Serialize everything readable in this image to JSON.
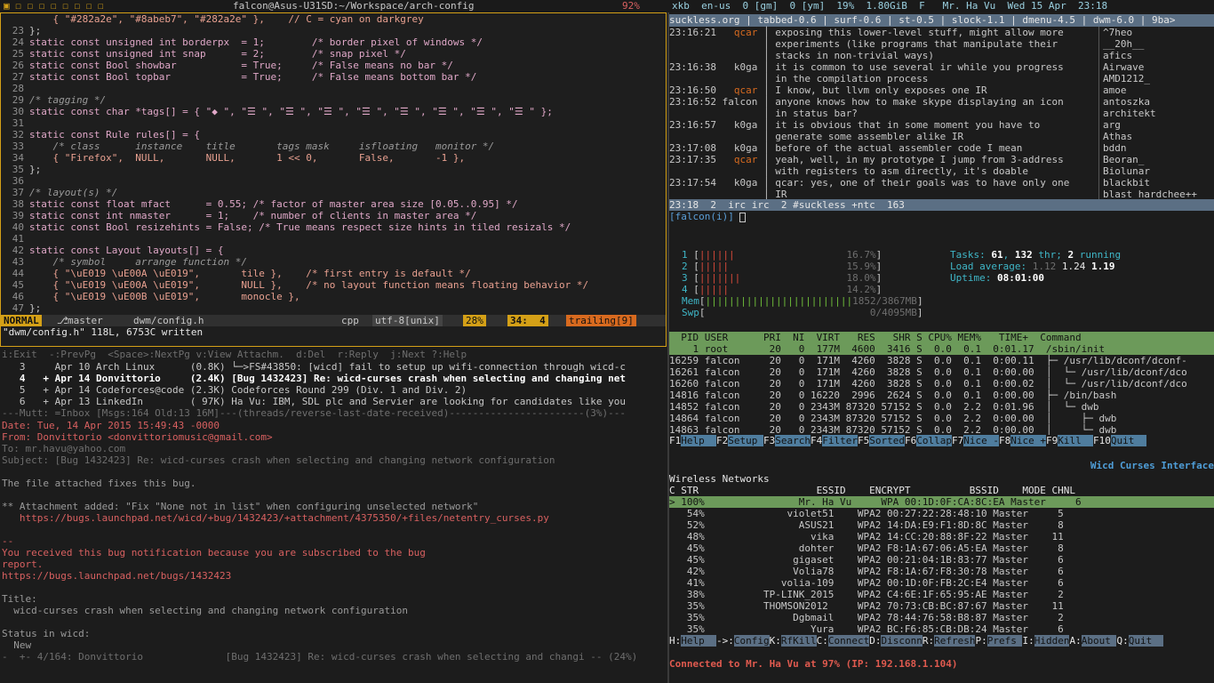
{
  "topbar": {
    "title": "falcon@Asus-U31SD:~/Workspace/arch-config",
    "battery": "92%",
    "right": "xkb  en-us  0 [gm]  0 [ym]  19%  1.80GiB  F   Mr. Ha Vu  Wed 15 Apr  23:18"
  },
  "vim": {
    "lines": [
      [
        "",
        "    { \"#282a2e\", \"#8abeb7\", \"#282a2e\" },    // C = cyan on darkgrey"
      ],
      [
        "23",
        "};"
      ],
      [
        "24",
        "static const unsigned int borderpx  = 1;        /* border pixel of windows */"
      ],
      [
        "25",
        "static const unsigned int snap      = 2;        /* snap pixel */"
      ],
      [
        "26",
        "static const Bool showbar           = True;     /* False means no bar */"
      ],
      [
        "27",
        "static const Bool topbar            = True;     /* False means bottom bar */"
      ],
      [
        "28",
        ""
      ],
      [
        "29",
        "/* tagging */"
      ],
      [
        "30",
        "static const char *tags[] = { \"◆ \", \"☰ \", \"☰ \", \"☰ \", \"☰ \", \"☰ \", \"☰ \", \"☰ \", \"☰ \" };"
      ],
      [
        "31",
        ""
      ],
      [
        "32",
        "static const Rule rules[] = {"
      ],
      [
        "33",
        "    /* class      instance    title       tags mask     isfloating   monitor */"
      ],
      [
        "34",
        "    { \"Firefox\",  NULL,       NULL,       1 << 0,       False,       -1 },"
      ],
      [
        "35",
        "};"
      ],
      [
        "36",
        ""
      ],
      [
        "37",
        "/* layout(s) */"
      ],
      [
        "38",
        "static const float mfact      = 0.55; /* factor of master area size [0.05..0.95] */"
      ],
      [
        "39",
        "static const int nmaster      = 1;    /* number of clients in master area */"
      ],
      [
        "40",
        "static const Bool resizehints = False; /* True means respect size hints in tiled resizals */"
      ],
      [
        "41",
        ""
      ],
      [
        "42",
        "static const Layout layouts[] = {"
      ],
      [
        "43",
        "    /* symbol     arrange function */"
      ],
      [
        "44",
        "    { \"\\uE019 \\uE00A \\uE019\",       tile },    /* first entry is default */"
      ],
      [
        "45",
        "    { \"\\uE019 \\uE00A \\uE019\",       NULL },    /* no layout function means floating behavior */"
      ],
      [
        "46",
        "    { \"\\uE019 \\uE00B \\uE019\",       monocle },"
      ],
      [
        "47",
        "};"
      ]
    ],
    "status_mode": "NORMAL",
    "status_branch": "master",
    "status_file": "dwm/config.h",
    "status_ft": "cpp",
    "status_enc": "utf-8[unix]",
    "status_pos": "28%",
    "status_line": "34:  4",
    "status_trailing": "trailing[9]",
    "cmdline": "\"dwm/config.h\" 118L, 6753C written"
  },
  "mutt": {
    "help": "i:Exit  -:PrevPg  <Space>:NextPg v:View Attachm.  d:Del  r:Reply  j:Next ?:Help",
    "list": [
      "   3     Apr 10 Arch Linux      (0.8K) └─>FS#43850: [wicd] fail to setup up wifi-connection through wicd-c",
      "   4   + Apr 14 Donvittorio     (2.4K) [Bug 1432423] Re: wicd-curses crash when selecting and changing net",
      "   5   + Apr 14 Codeforces@code (2.3K) Codeforces Round 299 (Div. 1 and Div. 2)",
      "   6   + Apr 13 LinkedIn        ( 97K) Ha Vu: IBM, SDL plc and Servier are looking for candidates like you"
    ],
    "statusbar": "---Mutt: =Inbox [Msgs:164 Old:13 16M]---(threads/reverse-last-date-received)-----------------------(3%)---",
    "date": "Date: Tue, 14 Apr 2015 15:49:43 -0000",
    "from": "From: Donvittorio <donvittoriomusic@gmail.com>",
    "to": "To: mr.havu@yahoo.com",
    "subject": "Subject: [Bug 1432423] Re: wicd-curses crash when selecting and changing network configuration",
    "body": [
      "",
      "The file attached fixes this bug.",
      "",
      "** Attachment added: \"Fix \"None not in list\" when configuring unselected network\"",
      "   https://bugs.launchpad.net/wicd/+bug/1432423/+attachment/4375350/+files/netentry_curses.py",
      "",
      "--",
      "You received this bug notification because you are subscribed to the bug",
      "report.",
      "https://bugs.launchpad.net/bugs/1432423",
      "",
      "Title:",
      "  wicd-curses crash when selecting and changing network configuration",
      "",
      "Status in wicd:",
      "  New"
    ],
    "footer": "-  +- 4/164: Donvittorio              [Bug 1432423] Re: wicd-curses crash when selecting and changi -- (24%)"
  },
  "irc": {
    "topic": "suckless.org | tabbed-0.6 | surf-0.6 | st-0.5 | slock-1.1 | dmenu-4.5 | dwm-6.0 | 9ba>",
    "messages": [
      [
        "23:16:21",
        "qcar",
        "exposing this lower-level stuff, might allow more"
      ],
      [
        "",
        "",
        "experiments (like programs that manipulate their"
      ],
      [
        "",
        "",
        "stacks in non-trivial ways)"
      ],
      [
        "23:16:38",
        "k0ga",
        "it is common to use several ir while you progress"
      ],
      [
        "",
        "",
        "in the compilation process"
      ],
      [
        "23:16:50",
        "qcar",
        "I know, but llvm only exposes one IR"
      ],
      [
        "23:16:52",
        "falcon",
        "anyone knows how to make skype displaying an icon"
      ],
      [
        "",
        "",
        "in status bar?"
      ],
      [
        "23:16:57",
        "k0ga",
        "it is obvious that in some moment you have to"
      ],
      [
        "",
        "",
        "generate some assembler alike IR"
      ],
      [
        "23:17:08",
        "k0ga",
        "before of the actual assembler code I mean"
      ],
      [
        "23:17:35",
        "qcar",
        "yeah, well, in my prototype I jump from 3-address"
      ],
      [
        "",
        "",
        "with registers to asm directly, it's doable"
      ],
      [
        "23:17:54",
        "k0ga",
        "qcar: yes, one of their goals was to have only one"
      ],
      [
        "",
        "",
        "IR"
      ]
    ],
    "nicks": [
      "^7heo",
      "__20h__",
      "afics",
      "Airwave",
      "AMD1212_",
      "amoe",
      "antoszka",
      "architekt",
      "arg",
      "Athas",
      "bddn",
      "Beoran_",
      "Biolunar",
      "blackbit",
      "blast_hardchee++"
    ],
    "status": "23:18  2  irc irc  2 #suckless +ntc  163",
    "prompt": "[falcon(i)] "
  },
  "htop": {
    "cpus": [
      [
        "1",
        "||||||",
        "16.7%"
      ],
      [
        "2",
        "|||||",
        "15.9%"
      ],
      [
        "3",
        "|||||||",
        "18.0%"
      ],
      [
        "4",
        "|||||",
        "14.2%"
      ]
    ],
    "cpu_usage": [
      16.7,
      15.9,
      18.0,
      14.2
    ],
    "mem_bars": "|||||||||||||||||||||||||",
    "mem": "1852/3867MB",
    "mem_used_mb": 1852,
    "mem_total_mb": 3867,
    "swp": "0/4095MB",
    "swp_used_mb": 0,
    "swp_total_mb": 4095,
    "tasks_label": "Tasks: ",
    "tasks": "61",
    "thr": "132",
    "running": "2",
    "load_label": "Load average: ",
    "load1": "1.12",
    "load5": "1.24",
    "load15": "1.19",
    "uptime_label": "Uptime: ",
    "uptime": "08:01:00",
    "header": "  PID USER      PRI  NI  VIRT   RES   SHR S CPU% MEM%   TIME+  Command",
    "rows": [
      "    1 root       20   0  177M  4600  3416 S  0.0  0.1  0:01.17  /sbin/init",
      "16259 falcon     20   0  171M  4260  3828 S  0.0  0.1  0:00.11  ├─ /usr/lib/dconf/dconf-",
      "16261 falcon     20   0  171M  4260  3828 S  0.0  0.1  0:00.00  │  └─ /usr/lib/dconf/dco",
      "16260 falcon     20   0  171M  4260  3828 S  0.0  0.1  0:00.02  │  └─ /usr/lib/dconf/dco",
      "14816 falcon     20   0 16220  2996  2624 S  0.0  0.1  0:00.00  ├─ /bin/bash",
      "14852 falcon     20   0 2343M 87320 57152 S  0.0  2.2  0:01.96  │  └─ dwb",
      "14864 falcon     20   0 2343M 87320 57152 S  0.0  2.2  0:00.00  │     ├─ dwb",
      "14863 falcon     20   0 2343M 87320 57152 S  0.0  2.2  0:00.00  │     └─ dwb"
    ],
    "fkeys": [
      [
        "F1",
        "Help  "
      ],
      [
        "F2",
        "Setup "
      ],
      [
        "F3",
        "Search"
      ],
      [
        "F4",
        "Filter"
      ],
      [
        "F5",
        "Sorted"
      ],
      [
        "F6",
        "Collap"
      ],
      [
        "F7",
        "Nice -"
      ],
      [
        "F8",
        "Nice +"
      ],
      [
        "F9",
        "Kill  "
      ],
      [
        "F10",
        "Quit  "
      ]
    ]
  },
  "wicd": {
    "title": "Wicd Curses Interface",
    "heading": "Wireless Networks",
    "columns": "C STR                    ESSID    ENCRYPT          BSSID    MODE CHNL",
    "selected": "> 100%                Mr. Ha Vu     WPA 00:1D:0F:CA:8C:EA Master     6",
    "networks": [
      "   54%              violet51    WPA2 00:27:22:28:48:10 Master     5",
      "   52%                ASUS21    WPA2 14:DA:E9:F1:8D:8C Master     8",
      "   48%                  vika    WPA2 14:CC:20:88:8F:22 Master    11",
      "   45%                dohter    WPA2 F8:1A:67:06:A5:EA Master     8",
      "   45%               gigaset    WPA2 00:21:04:1B:83:77 Master     6",
      "   42%               Volia78    WPA2 F8:1A:67:F8:30:78 Master     6",
      "   41%             volia-109    WPA2 00:1D:0F:FB:2C:E4 Master     6",
      "   38%          TP-LINK_2015    WPA2 C4:6E:1F:65:95:AE Master     2",
      "   35%          THOMSON2012     WPA2 70:73:CB:BC:87:67 Master    11",
      "   35%               Dgbmail    WPA2 78:44:76:58:B8:87 Master     2",
      "   35%                  Yura    WPA2 BC:F6:85:CB:DB:24 Master     6"
    ],
    "keys": [
      [
        "H:",
        "Help  "
      ],
      [
        "->:",
        "Config"
      ],
      [
        "K:",
        "RfKill"
      ],
      [
        "C:",
        "Connect"
      ],
      [
        "D:",
        "Disconn"
      ],
      [
        "R:",
        "Refresh"
      ],
      [
        "P:",
        "Prefs "
      ],
      [
        "I:",
        "Hidden"
      ],
      [
        "A:",
        "About "
      ],
      [
        "Q:",
        "Quit  "
      ]
    ],
    "connected": "Connected to Mr. Ha Vu at 97% (IP: 192.168.1.104)"
  }
}
